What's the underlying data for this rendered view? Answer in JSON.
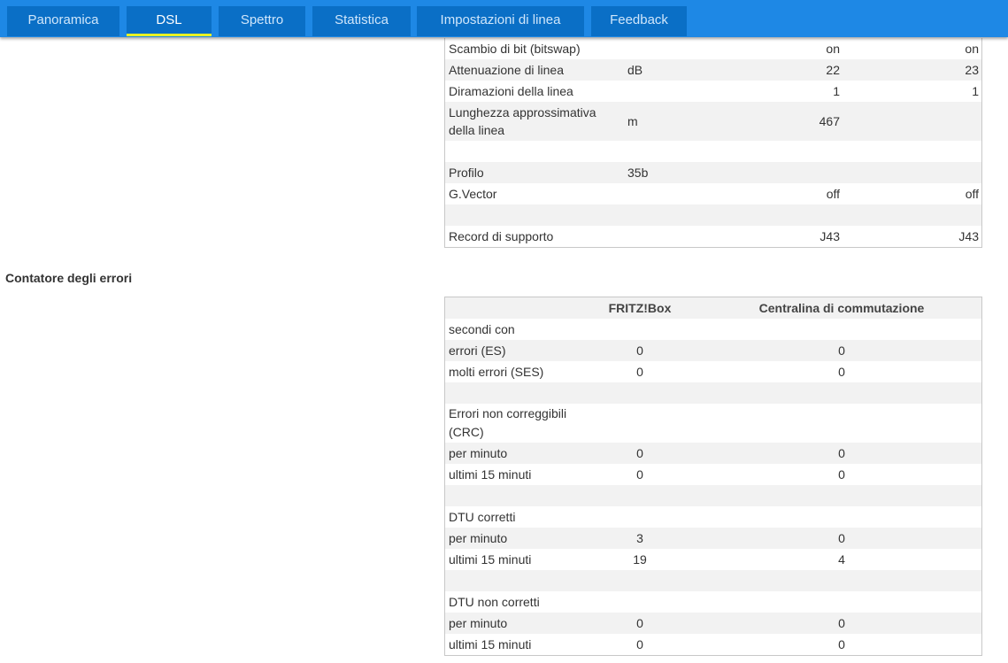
{
  "tabs": [
    {
      "label": "Panoramica",
      "active": false
    },
    {
      "label": "DSL",
      "active": true
    },
    {
      "label": "Spettro",
      "active": false
    },
    {
      "label": "Statistica",
      "active": false
    },
    {
      "label": "Impostazioni di linea",
      "active": false
    },
    {
      "label": "Feedback",
      "active": false
    }
  ],
  "line_table": {
    "rows": [
      {
        "label": "Scambio di bit (bitswap)",
        "unit": "",
        "v1": "on",
        "v2": "on"
      },
      {
        "label": "Attenuazione di linea",
        "unit": "dB",
        "v1": "22",
        "v2": "23"
      },
      {
        "label": "Diramazioni della linea",
        "unit": "",
        "v1": "1",
        "v2": "1"
      },
      {
        "label": "Lunghezza approssimativa della linea",
        "unit": "m",
        "v1": "467",
        "v2": ""
      },
      {
        "label": "",
        "unit": "",
        "v1": "",
        "v2": ""
      },
      {
        "label": "Profilo",
        "unit": "35b",
        "v1": "",
        "v2": ""
      },
      {
        "label": "G.Vector",
        "unit": "",
        "v1": "off",
        "v2": "off"
      },
      {
        "label": "",
        "unit": "",
        "v1": "",
        "v2": ""
      },
      {
        "label": "Record di supporto",
        "unit": "",
        "v1": "J43",
        "v2": "J43"
      }
    ]
  },
  "errors": {
    "title": "Contatore degli errori",
    "col1": "FRITZ!Box",
    "col2": "Centralina di commutazione",
    "rows": [
      {
        "label": "secondi con",
        "v1": "",
        "v2": ""
      },
      {
        "label": "errori (ES)",
        "v1": "0",
        "v2": "0"
      },
      {
        "label": "molti errori (SES)",
        "v1": "0",
        "v2": "0"
      },
      {
        "label": "",
        "v1": "",
        "v2": ""
      },
      {
        "label": "Errori non correggibili (CRC)",
        "v1": "",
        "v2": ""
      },
      {
        "label": "per minuto",
        "v1": "0",
        "v2": "0"
      },
      {
        "label": "ultimi 15 minuti",
        "v1": "0",
        "v2": "0"
      },
      {
        "label": "",
        "v1": "",
        "v2": ""
      },
      {
        "label": "DTU corretti",
        "v1": "",
        "v2": ""
      },
      {
        "label": "per minuto",
        "v1": "3",
        "v2": "0"
      },
      {
        "label": "ultimi 15 minuti",
        "v1": "19",
        "v2": "4"
      },
      {
        "label": "",
        "v1": "",
        "v2": ""
      },
      {
        "label": "DTU non corretti",
        "v1": "",
        "v2": ""
      },
      {
        "label": "per minuto",
        "v1": "0",
        "v2": "0"
      },
      {
        "label": "ultimi 15 minuti",
        "v1": "0",
        "v2": "0"
      }
    ]
  },
  "colors": {
    "tabbar": "#1e88e5",
    "tab": "#0a6fc6",
    "active_underline": "#e8f224",
    "row_alt": "#f2f2f2"
  }
}
